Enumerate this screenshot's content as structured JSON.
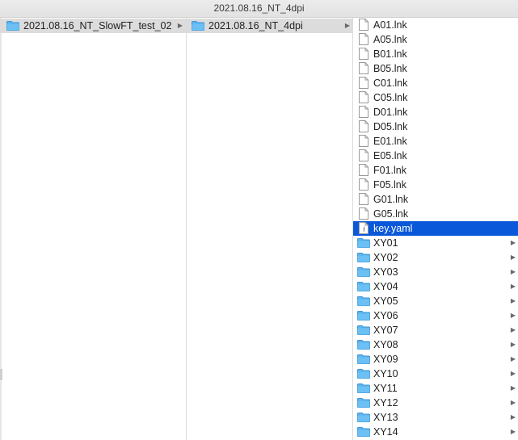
{
  "window": {
    "title": "2021.08.16_NT_4dpi"
  },
  "column1": {
    "selected": {
      "name": "2021.08.16_NT_SlowFT_test_02",
      "icon": "folder-icon"
    }
  },
  "column2": {
    "selected": {
      "name": "2021.08.16_NT_4dpi",
      "icon": "folder-icon"
    }
  },
  "column3": {
    "items": [
      {
        "name": "A01.lnk",
        "kind": "file"
      },
      {
        "name": "A05.lnk",
        "kind": "file"
      },
      {
        "name": "B01.lnk",
        "kind": "file"
      },
      {
        "name": "B05.lnk",
        "kind": "file"
      },
      {
        "name": "C01.lnk",
        "kind": "file"
      },
      {
        "name": "C05.lnk",
        "kind": "file"
      },
      {
        "name": "D01.lnk",
        "kind": "file"
      },
      {
        "name": "D05.lnk",
        "kind": "file"
      },
      {
        "name": "E01.lnk",
        "kind": "file"
      },
      {
        "name": "E05.lnk",
        "kind": "file"
      },
      {
        "name": "F01.lnk",
        "kind": "file"
      },
      {
        "name": "F05.lnk",
        "kind": "file"
      },
      {
        "name": "G01.lnk",
        "kind": "file"
      },
      {
        "name": "G05.lnk",
        "kind": "file"
      },
      {
        "name": "key.yaml",
        "kind": "yaml",
        "selected": true
      },
      {
        "name": "XY01",
        "kind": "folder"
      },
      {
        "name": "XY02",
        "kind": "folder"
      },
      {
        "name": "XY03",
        "kind": "folder"
      },
      {
        "name": "XY04",
        "kind": "folder"
      },
      {
        "name": "XY05",
        "kind": "folder"
      },
      {
        "name": "XY06",
        "kind": "folder"
      },
      {
        "name": "XY07",
        "kind": "folder"
      },
      {
        "name": "XY08",
        "kind": "folder"
      },
      {
        "name": "XY09",
        "kind": "folder"
      },
      {
        "name": "XY10",
        "kind": "folder"
      },
      {
        "name": "XY11",
        "kind": "folder"
      },
      {
        "name": "XY12",
        "kind": "folder"
      },
      {
        "name": "XY13",
        "kind": "folder"
      },
      {
        "name": "XY14",
        "kind": "folder"
      }
    ]
  },
  "colors": {
    "selection_active": "#0958d9",
    "selection_inactive": "#dcdcdc",
    "folder": "#5db4ee"
  }
}
